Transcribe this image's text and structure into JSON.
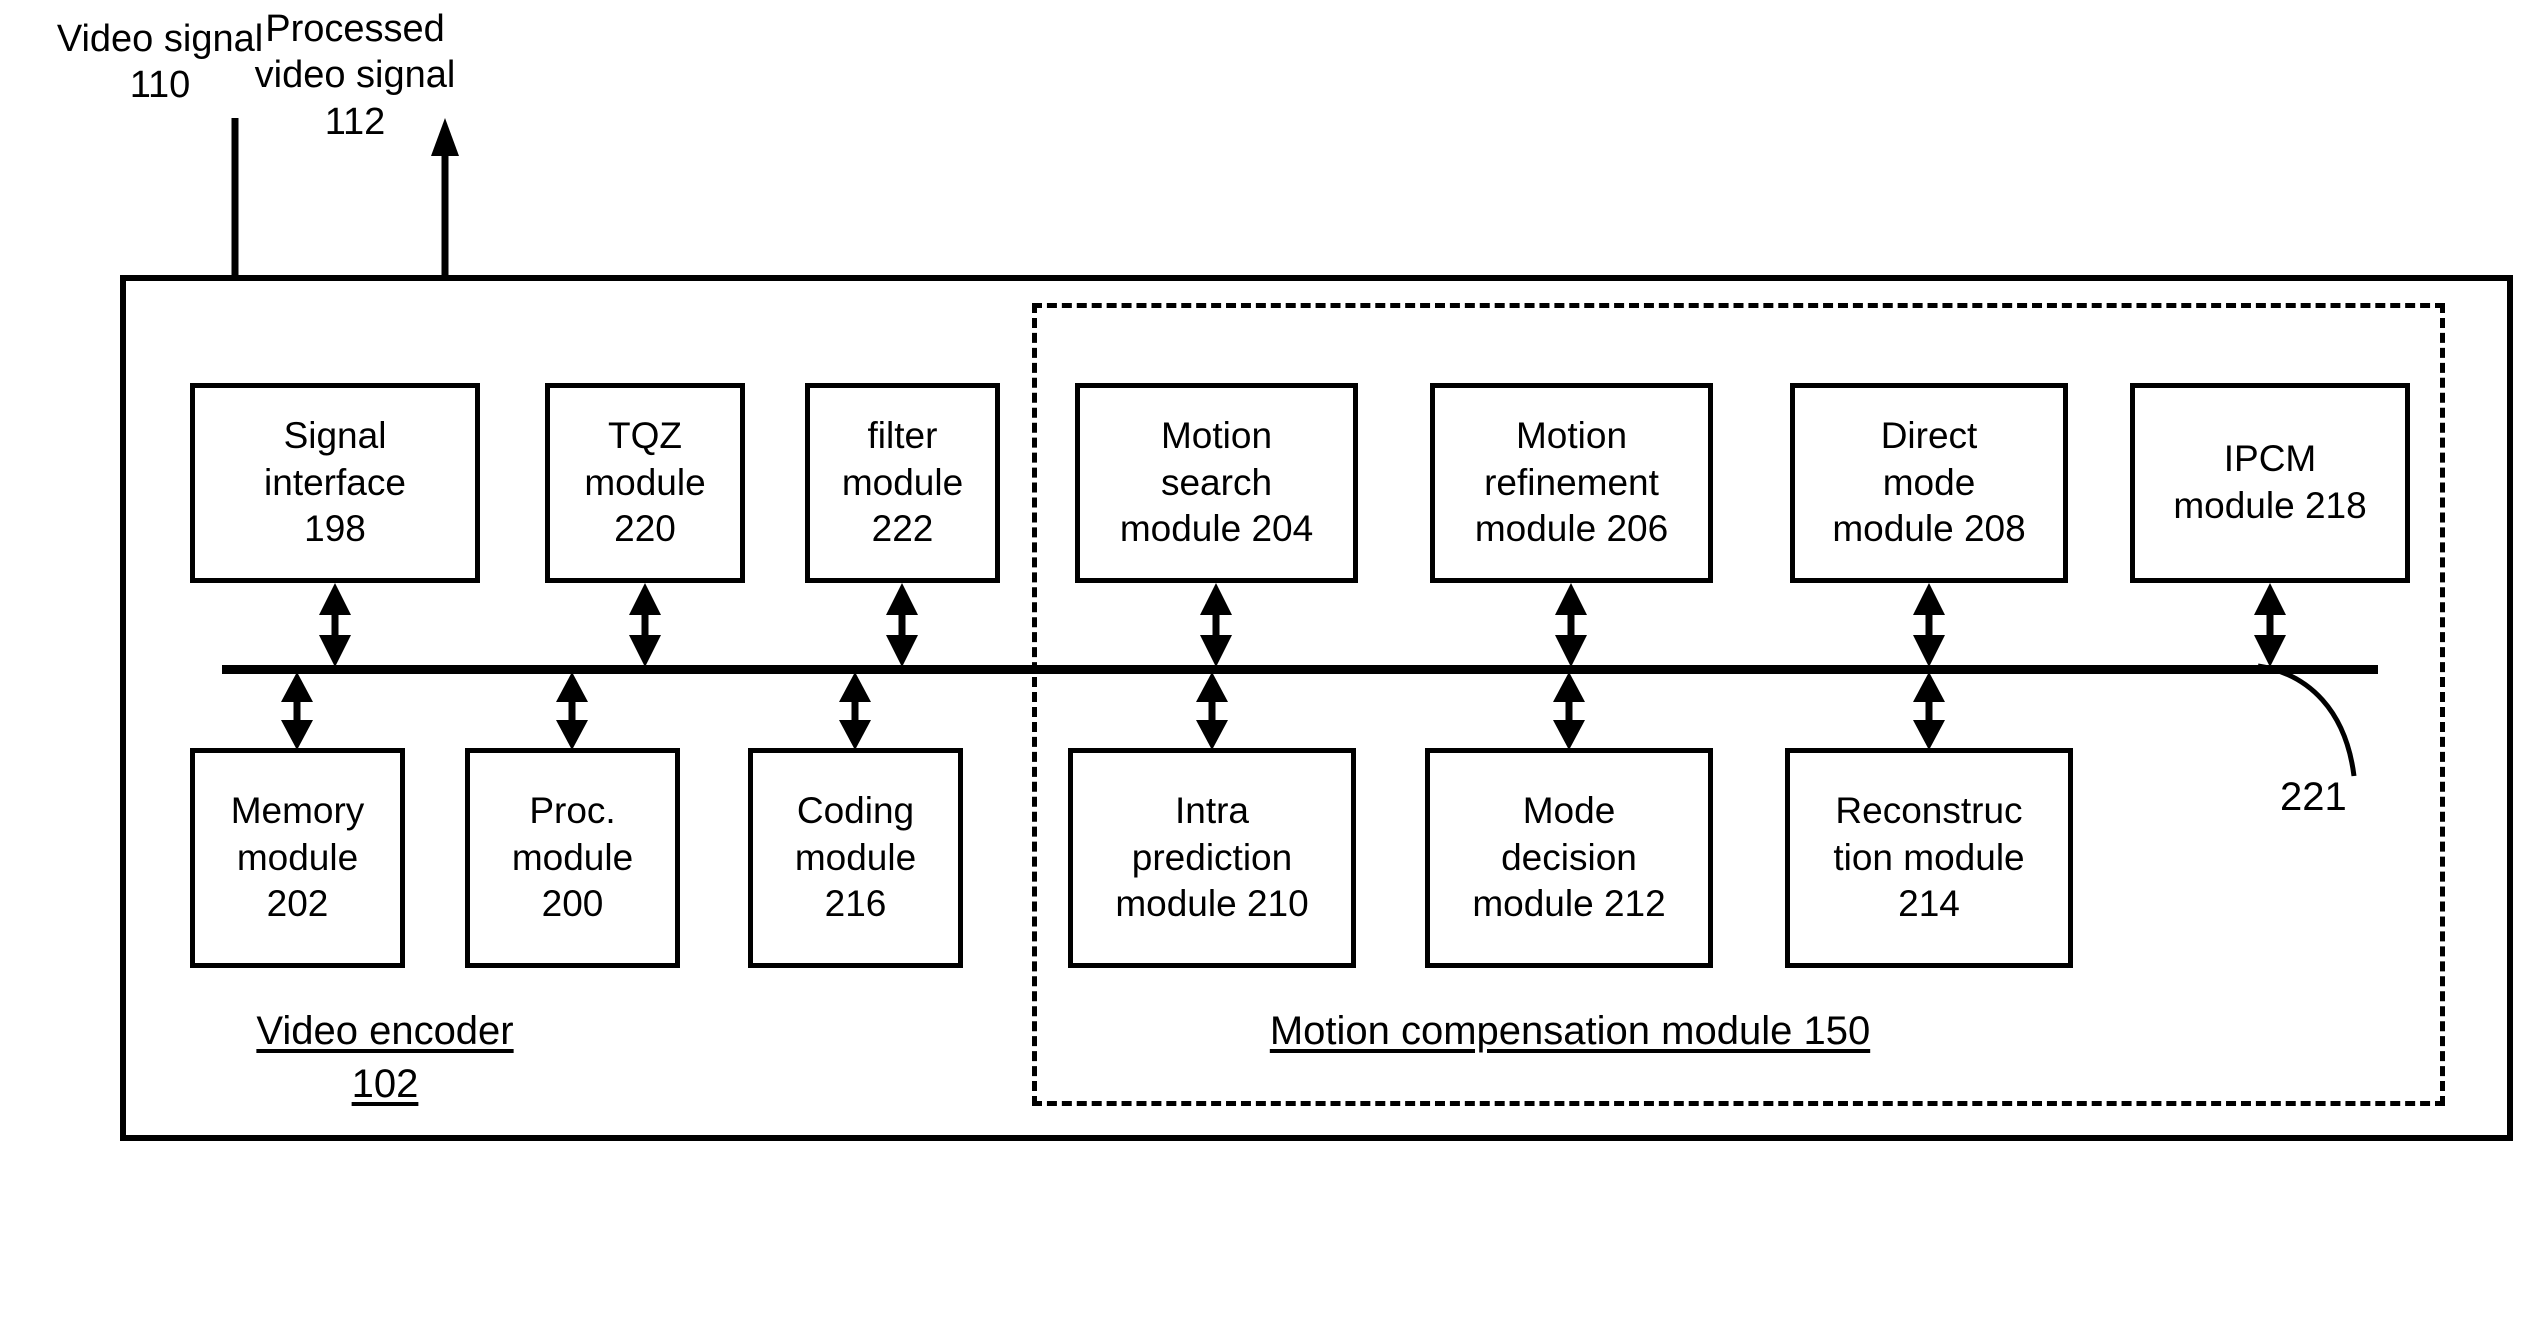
{
  "figure": {
    "title": "Video encoder block diagram",
    "signals": [
      {
        "id": "in",
        "label": "Video signal\n110",
        "direction": "into-encoder"
      },
      {
        "id": "out",
        "label": "Processed\nvideo signal\n112",
        "direction": "out-of-encoder"
      }
    ],
    "containers": {
      "encoder": {
        "caption_line1": "Video encoder",
        "caption_line2": "102",
        "border": "solid"
      },
      "motion_compensation": {
        "caption": "Motion compensation module 150",
        "border": "dashed"
      }
    },
    "bus": {
      "reference": "221"
    },
    "modules_top": [
      {
        "name": "signal-interface",
        "label": "Signal\ninterface\n198",
        "ref": "198"
      },
      {
        "name": "tqz-module",
        "label": "TQZ\nmodule\n220",
        "ref": "220"
      },
      {
        "name": "filter-module",
        "label": "filter\nmodule\n222",
        "ref": "222"
      },
      {
        "name": "motion-search",
        "label": "Motion\nsearch\nmodule 204",
        "ref": "204"
      },
      {
        "name": "motion-refinement",
        "label": "Motion\nrefinement\nmodule 206",
        "ref": "206"
      },
      {
        "name": "direct-mode",
        "label": "Direct\nmode\nmodule 208",
        "ref": "208"
      },
      {
        "name": "ipcm-module",
        "label": "IPCM\nmodule 218",
        "ref": "218"
      }
    ],
    "modules_bottom": [
      {
        "name": "memory-module",
        "label": "Memory\nmodule\n202",
        "ref": "202"
      },
      {
        "name": "proc-module",
        "label": "Proc.\nmodule\n200",
        "ref": "200"
      },
      {
        "name": "coding-module",
        "label": "Coding\nmodule\n216",
        "ref": "216"
      },
      {
        "name": "intra-prediction",
        "label": "Intra\nprediction\nmodule 210",
        "ref": "210"
      },
      {
        "name": "mode-decision",
        "label": "Mode\ndecision\nmodule 212",
        "ref": "212"
      },
      {
        "name": "reconstruction",
        "label": "Reconstruc\ntion module\n214",
        "ref": "214"
      }
    ],
    "colors": {
      "ink": "#000000",
      "paper": "#ffffff"
    }
  }
}
